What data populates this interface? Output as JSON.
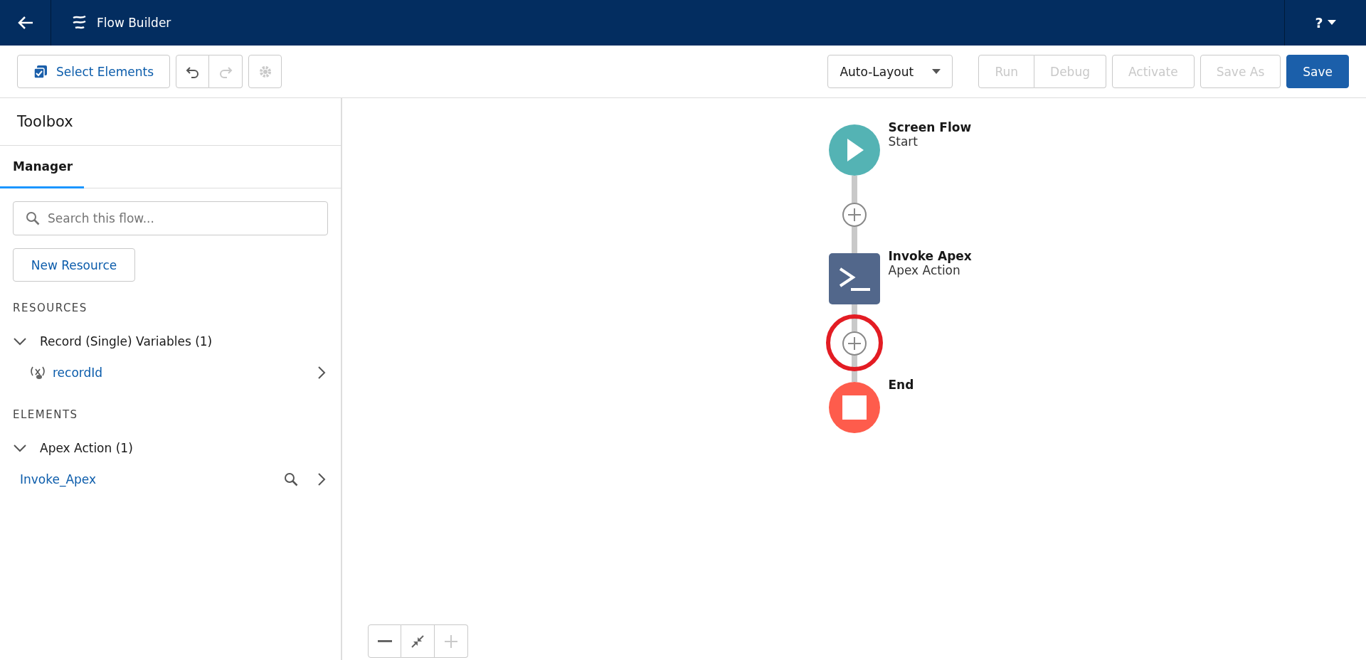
{
  "header": {
    "title": "Flow Builder",
    "help": "?"
  },
  "toolbar": {
    "select_elements": "Select Elements",
    "undo": {
      "disabled": false
    },
    "redo": {
      "disabled": true
    },
    "settings": {
      "disabled": true
    },
    "layout": "Auto-Layout",
    "action_groups": [
      [
        {
          "label": "Run",
          "disabled": true
        },
        {
          "label": "Debug",
          "disabled": true
        }
      ],
      [
        {
          "label": "Activate",
          "disabled": true
        }
      ],
      [
        {
          "label": "Save As",
          "disabled": true
        }
      ],
      [
        {
          "label": "Save",
          "disabled": false
        }
      ]
    ]
  },
  "toolbox": {
    "title": "Toolbox",
    "tabs": [
      {
        "label": "Manager",
        "selected": true
      }
    ],
    "search": {
      "placeholder": "Search this flow..."
    },
    "new_resource": "New Resource",
    "sections": [
      {
        "heading": "RESOURCES",
        "groups": [
          {
            "label": "Record (Single) Variables (1)",
            "expanded": true,
            "children": [
              {
                "label": "recordId",
                "kind": "variable"
              }
            ]
          }
        ]
      },
      {
        "heading": "ELEMENTS",
        "groups": [
          {
            "label": "Apex Action (1)",
            "expanded": true,
            "children": [
              {
                "label": "Invoke_Apex",
                "kind": "element"
              }
            ]
          }
        ]
      }
    ]
  },
  "canvas": {
    "nodes": [
      {
        "kind": "start",
        "title": "Screen Flow",
        "subtitle": "Start"
      },
      {
        "kind": "action",
        "title": "Invoke Apex",
        "subtitle": "Apex Action",
        "highlighted_add_after": true
      },
      {
        "kind": "end",
        "title": "End"
      }
    ],
    "zoom": [
      {
        "kind": "out",
        "disabled": false
      },
      {
        "kind": "fit",
        "disabled": false
      },
      {
        "kind": "in",
        "disabled": true
      }
    ]
  }
}
